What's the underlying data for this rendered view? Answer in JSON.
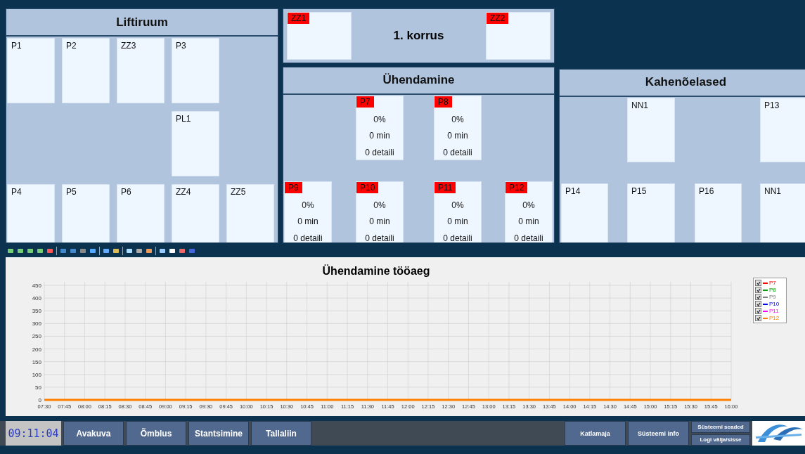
{
  "liftiruum": {
    "title": "Liftiruum",
    "cards": [
      {
        "label": "P1",
        "alarm": false
      },
      {
        "label": "P2",
        "alarm": false
      },
      {
        "label": "ZZ3",
        "alarm": false
      },
      {
        "label": "P3",
        "alarm": false
      },
      {
        "label": "PL1",
        "alarm": false
      },
      {
        "label": "P4",
        "alarm": false
      },
      {
        "label": "P5",
        "alarm": false
      },
      {
        "label": "P6",
        "alarm": false
      },
      {
        "label": "ZZ4",
        "alarm": false
      },
      {
        "label": "ZZ5",
        "alarm": false
      }
    ]
  },
  "korrus": {
    "title": "1. korrus",
    "cards": [
      {
        "label": "ZZ1",
        "alarm": true
      },
      {
        "label": "ZZ2",
        "alarm": true
      }
    ]
  },
  "uhendamine": {
    "title": "Ühendamine",
    "cards": [
      {
        "label": "P7",
        "alarm": true,
        "percent": "0%",
        "minutes": "0 min",
        "parts": "0 detaili"
      },
      {
        "label": "P8",
        "alarm": true,
        "percent": "0%",
        "minutes": "0 min",
        "parts": "0 detaili"
      },
      {
        "label": "P9",
        "alarm": true,
        "percent": "0%",
        "minutes": "0 min",
        "parts": "0 detaili"
      },
      {
        "label": "P10",
        "alarm": true,
        "percent": "0%",
        "minutes": "0 min",
        "parts": "0 detaili"
      },
      {
        "label": "P11",
        "alarm": true,
        "percent": "0%",
        "minutes": "0 min",
        "parts": "0 detaili"
      },
      {
        "label": "P12",
        "alarm": true,
        "percent": "0%",
        "minutes": "0 min",
        "parts": "0 detaili"
      }
    ]
  },
  "kahenoelased": {
    "title": "Kahenõelased",
    "cards": [
      {
        "label": "NN1",
        "alarm": false
      },
      {
        "label": "P13",
        "alarm": false
      },
      {
        "label": "P14",
        "alarm": false
      },
      {
        "label": "P15",
        "alarm": false
      },
      {
        "label": "P16",
        "alarm": false
      },
      {
        "label": "NN1",
        "alarm": false
      }
    ]
  },
  "chart": {
    "chart_data": {
      "type": "line",
      "title": "Ühendamine tööaeg",
      "grid": true,
      "categories": [
        "07:30",
        "07:45",
        "08:00",
        "08:15",
        "08:30",
        "08:45",
        "09:00",
        "09:15",
        "09:30",
        "09:45",
        "10:00",
        "10:15",
        "10:30",
        "10:45",
        "11:00",
        "11:15",
        "11:30",
        "11:45",
        "12:00",
        "12:15",
        "12:30",
        "12:45",
        "13:00",
        "13:15",
        "13:30",
        "13:45",
        "14:00",
        "14:15",
        "14:30",
        "14:45",
        "15:00",
        "15:15",
        "15:30",
        "15:45",
        "16:00"
      ],
      "ylim": [
        0,
        450
      ],
      "yticks": [
        0,
        50,
        100,
        150,
        200,
        250,
        300,
        350,
        400,
        450
      ],
      "series": [
        {
          "name": "P12",
          "color": "#ff8000",
          "values": [
            0,
            0,
            0,
            0,
            0,
            0,
            0,
            0,
            0,
            0,
            0,
            0,
            0,
            0,
            0,
            0,
            0,
            0,
            0,
            0,
            0,
            0,
            0,
            0,
            0,
            0,
            0,
            0,
            0,
            0,
            0,
            0,
            0,
            0,
            0
          ]
        }
      ]
    },
    "legend": [
      {
        "label": "P7",
        "color": "#ff0000",
        "checked": true
      },
      {
        "label": "P8",
        "color": "#00a000",
        "checked": true
      },
      {
        "label": "P9",
        "color": "#808080",
        "checked": true
      },
      {
        "label": "P10",
        "color": "#0000ff",
        "checked": true
      },
      {
        "label": "P11",
        "color": "#ff00ff",
        "checked": true
      }
    ],
    "series_legend": [
      {
        "checked": true
      }
    ]
  },
  "status_bar": {
    "clock": "09:11:04",
    "nav_buttons": [
      "Avakuva",
      "Õmblus",
      "Stantsimine",
      "Tallaliin"
    ],
    "right_buttons": [
      "Katlamaja",
      "Süsteemi info"
    ],
    "stacked_buttons": [
      "Süsteemi seaded",
      "Logi välja/sisse"
    ]
  }
}
